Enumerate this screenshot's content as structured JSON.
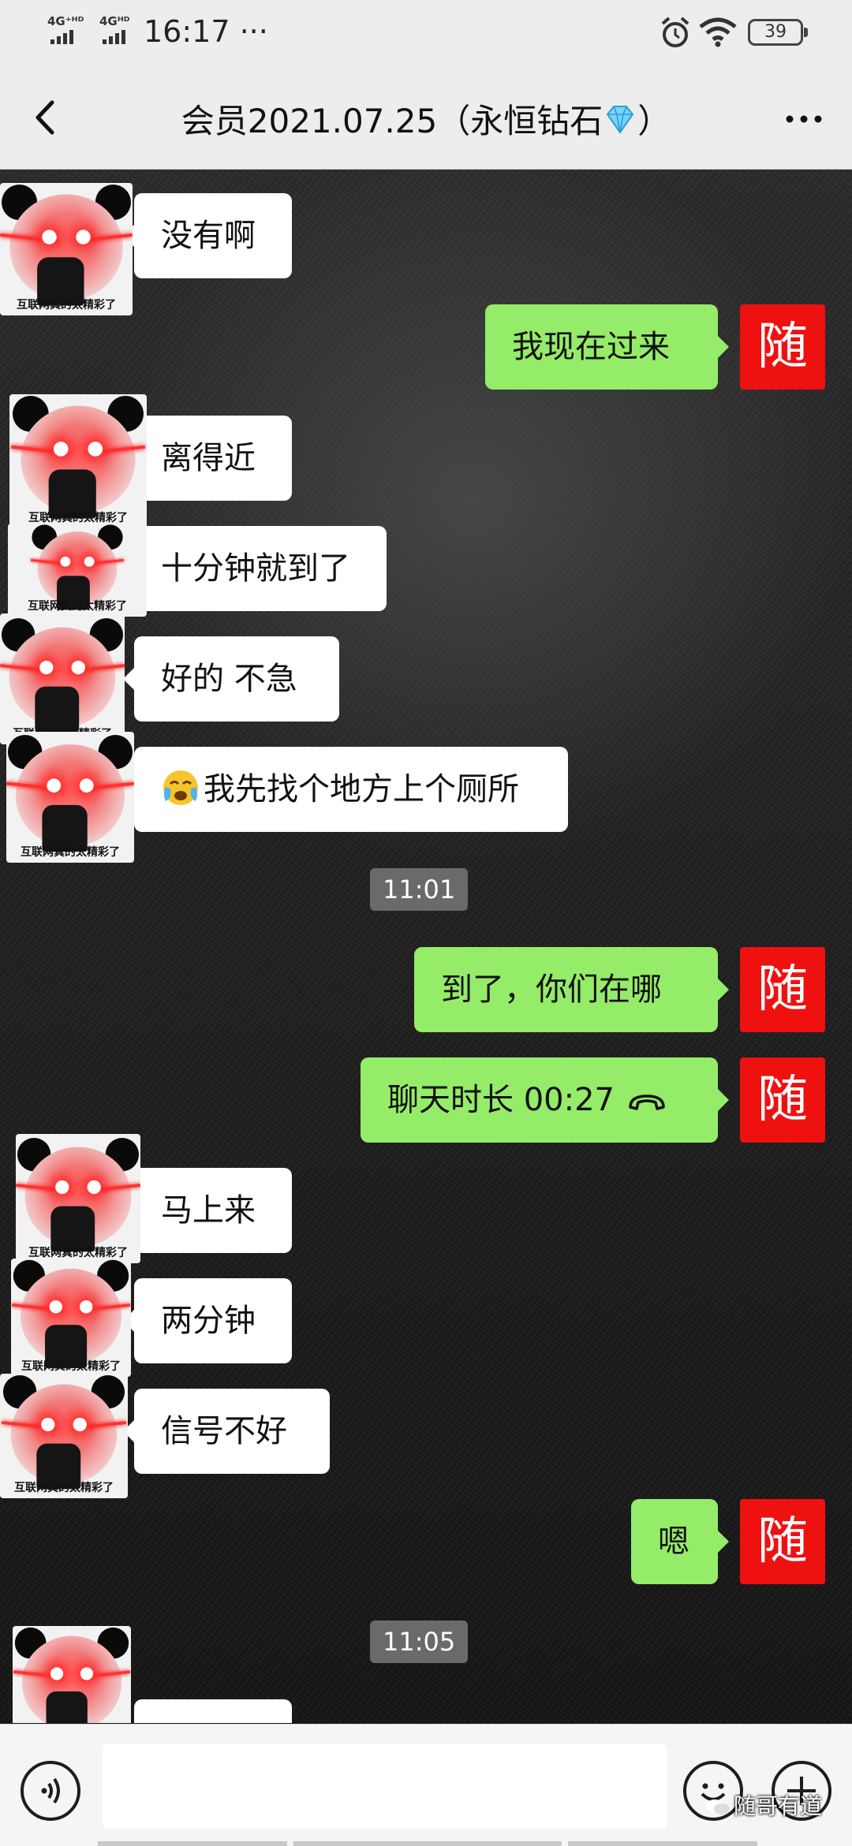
{
  "status_bar": {
    "signal1": "4G⁺ᴴᴰ",
    "signal2": "4Gᴴᴰ",
    "time": "16:17 ···",
    "battery": "39"
  },
  "header": {
    "title_prefix": "会员2021.07.25（永恒钻石",
    "title_suffix": "）"
  },
  "avatar_caption": "互联网真的太精彩了",
  "my_avatar_char": "随",
  "messages": [
    {
      "side": "in",
      "text": "没有啊"
    },
    {
      "side": "out",
      "text": "我现在过来"
    },
    {
      "side": "in",
      "text": "离得近"
    },
    {
      "side": "in",
      "text": "十分钟就到了"
    },
    {
      "side": "in",
      "text": "好的 不急"
    },
    {
      "side": "in",
      "text": "我先找个地方上个厕所",
      "emoji": "crying-face"
    },
    {
      "side": "time",
      "text": "11:01"
    },
    {
      "side": "out",
      "text": "到了，你们在哪"
    },
    {
      "side": "out",
      "text": "聊天时长 00:27",
      "call": true
    },
    {
      "side": "in",
      "text": "马上来"
    },
    {
      "side": "in",
      "text": "两分钟"
    },
    {
      "side": "in",
      "text": "信号不好"
    },
    {
      "side": "out",
      "text": "嗯"
    },
    {
      "side": "time",
      "text": "11:05"
    },
    {
      "side": "in",
      "text": ""
    }
  ],
  "input": {
    "value": "",
    "placeholder": ""
  },
  "watermark": "随哥有道",
  "colors": {
    "out_bubble": "#95ec69",
    "in_bubble": "#ffffff",
    "my_avatar": "#ef1010",
    "bar_bg": "#ededed"
  }
}
